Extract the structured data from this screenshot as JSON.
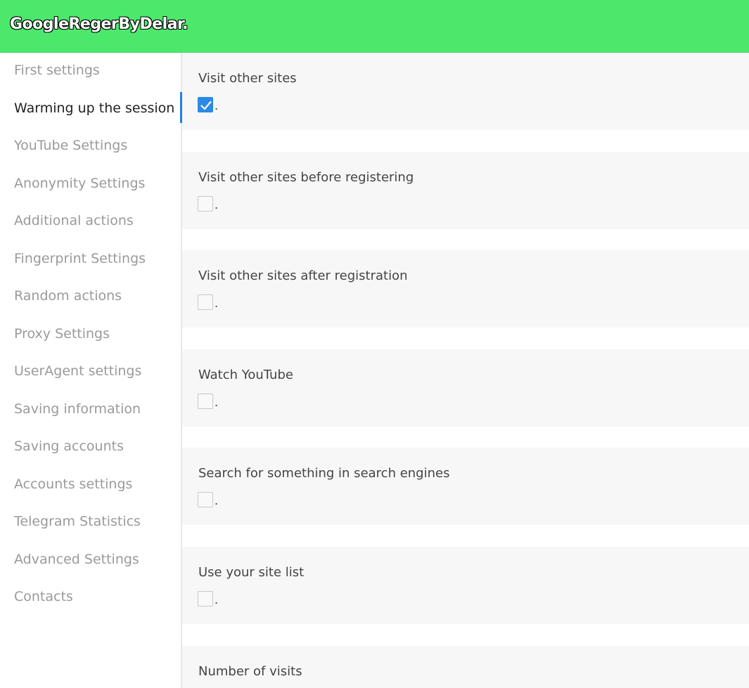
{
  "header": {
    "title": "GoogleRegerByDelar."
  },
  "sidebar": {
    "items": [
      {
        "label": "First settings",
        "active": false
      },
      {
        "label": "Warming up the session",
        "active": true
      },
      {
        "label": "YouTube Settings",
        "active": false
      },
      {
        "label": "Anonymity Settings",
        "active": false
      },
      {
        "label": "Additional actions",
        "active": false
      },
      {
        "label": "Fingerprint Settings",
        "active": false
      },
      {
        "label": "Random actions",
        "active": false
      },
      {
        "label": "Proxy Settings",
        "active": false
      },
      {
        "label": "UserAgent settings",
        "active": false
      },
      {
        "label": "Saving information",
        "active": false
      },
      {
        "label": "Saving accounts",
        "active": false
      },
      {
        "label": "Accounts settings",
        "active": false
      },
      {
        "label": "Telegram Statistics",
        "active": false
      },
      {
        "label": "Advanced Settings",
        "active": false
      },
      {
        "label": "Contacts",
        "active": false
      }
    ]
  },
  "main": {
    "settings": [
      {
        "label": "Visit other sites",
        "checked": true,
        "suffix": "."
      },
      {
        "label": "Visit other sites before registering",
        "checked": false,
        "suffix": "."
      },
      {
        "label": "Visit other sites after registration",
        "checked": false,
        "suffix": "."
      },
      {
        "label": "Watch YouTube",
        "checked": false,
        "suffix": "."
      },
      {
        "label": "Search for something in search engines",
        "checked": false,
        "suffix": "."
      },
      {
        "label": "Use your site list",
        "checked": false,
        "suffix": "."
      },
      {
        "label": "Number of visits"
      }
    ]
  },
  "colors": {
    "header": "#4ce86c",
    "accent": "#1e82e6",
    "card": "#f7f7f7"
  }
}
